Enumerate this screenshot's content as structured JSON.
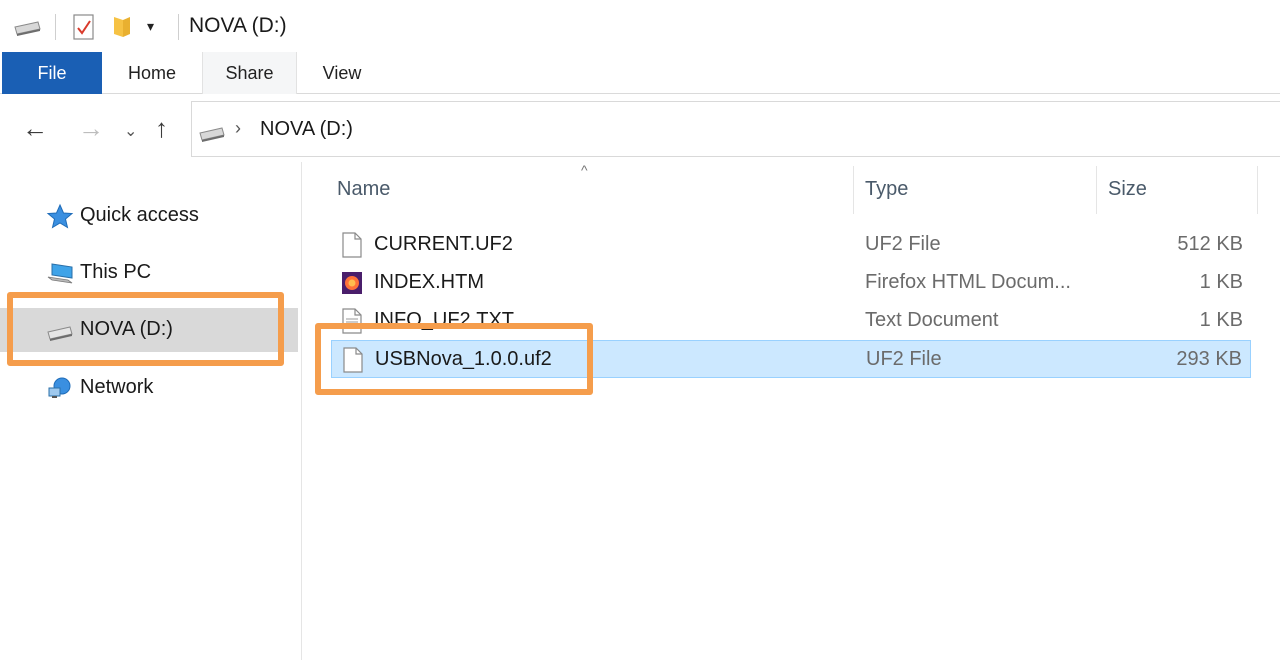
{
  "window": {
    "title": "NOVA (D:)"
  },
  "quick_access_toolbar": {
    "icons": [
      "drive-icon",
      "properties-icon",
      "new-folder-icon",
      "customize-dropdown-icon"
    ],
    "dropdown_glyph": "▾"
  },
  "ribbon": {
    "tabs": [
      {
        "label": "File",
        "active": true
      },
      {
        "label": "Home"
      },
      {
        "label": "Share"
      },
      {
        "label": "View"
      }
    ]
  },
  "navigation": {
    "back": "←",
    "forward": "→",
    "recent": "⌄",
    "up": "↑"
  },
  "address_bar": {
    "chevron": "›",
    "path": "NOVA (D:)"
  },
  "nav_pane": {
    "items": [
      {
        "label": "Quick access",
        "icon": "star-icon"
      },
      {
        "label": "This PC",
        "icon": "computer-icon"
      },
      {
        "label": "NOVA (D:)",
        "icon": "drive-icon",
        "selected": true
      },
      {
        "label": "Network",
        "icon": "network-icon"
      }
    ]
  },
  "file_list": {
    "sort_indicator": "^",
    "columns": {
      "name": "Name",
      "type": "Type",
      "size": "Size"
    },
    "rows": [
      {
        "name": "CURRENT.UF2",
        "type": "UF2 File",
        "size": "512 KB",
        "icon": "file-icon"
      },
      {
        "name": "INDEX.HTM",
        "type": "Firefox HTML Docum...",
        "size": "1 KB",
        "icon": "firefox-html-icon"
      },
      {
        "name": "INFO_UF2.TXT",
        "type": "Text Document",
        "size": "1 KB",
        "icon": "text-file-icon"
      },
      {
        "name": "USBNova_1.0.0.uf2",
        "type": "UF2 File",
        "size": "293 KB",
        "icon": "file-icon",
        "selected": true
      }
    ]
  },
  "colors": {
    "file_tab": "#1a5fb4",
    "highlight": "#f59d4c",
    "selection": "#cce8ff"
  }
}
